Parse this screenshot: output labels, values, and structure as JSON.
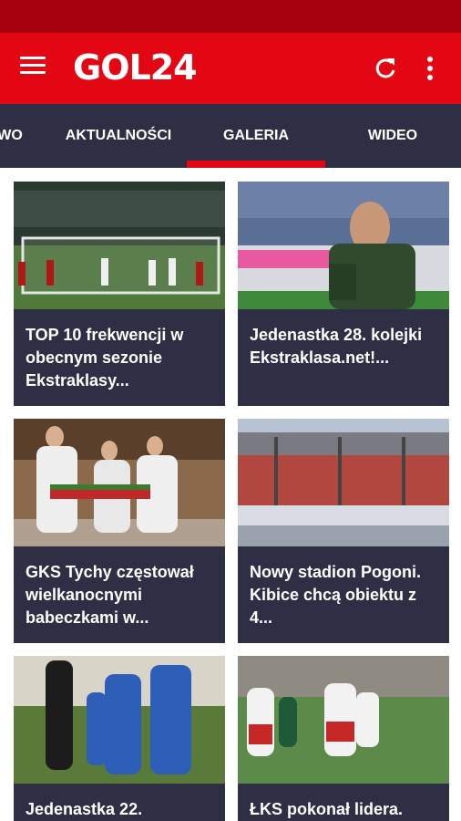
{
  "app": {
    "logo_text": "GOL24"
  },
  "appbar": {
    "menu_icon": "hamburger-menu-icon",
    "refresh_icon": "refresh-icon",
    "more_icon": "more-vertical-icon"
  },
  "tabs": [
    {
      "label": "WO"
    },
    {
      "label": "AKTUALNOŚCI"
    },
    {
      "label": "GALERIA",
      "selected": true
    },
    {
      "label": "WIDEO"
    }
  ],
  "colors": {
    "brand_red": "#e30613",
    "status_dark_red": "#a6000f",
    "tabbar": "#2e2e45",
    "card_bg": "#2e2e45"
  },
  "cards": [
    {
      "title": "TOP 10 frekwencji w obecnym sezonie Ekstraklasy..."
    },
    {
      "title": "Jedenastka 28. kolejki Ekstraklasa.net!..."
    },
    {
      "title": "GKS Tychy częstował wielkanocnymi babeczkami w..."
    },
    {
      "title": "Nowy stadion Pogoni. Kibice chcą obiektu z 4..."
    },
    {
      "title": "Jedenastka 22."
    },
    {
      "title": "ŁKS pokonał lidera."
    }
  ]
}
